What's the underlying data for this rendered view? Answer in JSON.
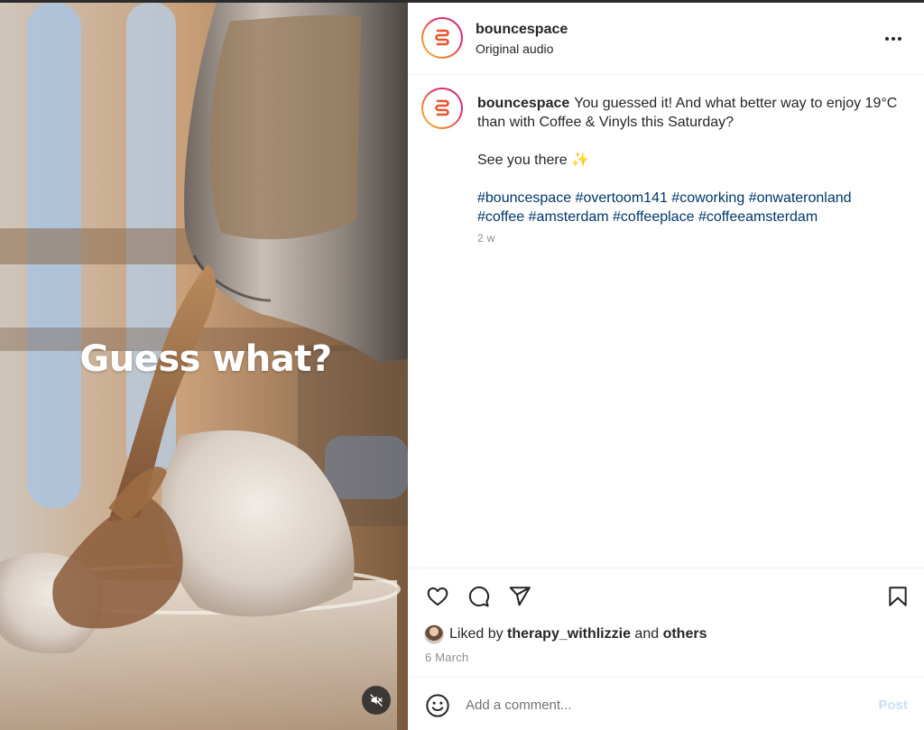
{
  "post": {
    "username": "bouncespace",
    "audio_label": "Original audio",
    "overlay_text": "Guess what?",
    "caption": {
      "username": "bouncespace",
      "line1": "You guessed it! And what better way to enjoy 19°C than with Coffee & Vinyls this Saturday?",
      "line2": "See you there ✨",
      "hashtags": [
        "#bouncespace",
        "#overtoom141",
        "#coworking",
        "#onwateronland",
        "#coffee",
        "#amsterdam",
        "#coffeeplace",
        "#coffeeamsterdam"
      ],
      "age": "2 w"
    },
    "likes": {
      "prefix": "Liked by",
      "user": "therapy_withlizzie",
      "joiner": "and",
      "others": "others"
    },
    "date": "6 March",
    "comment": {
      "placeholder": "Add a comment...",
      "post_label": "Post"
    }
  },
  "icons": {
    "more": "more-options-icon",
    "like": "heart-icon",
    "comment": "comment-icon",
    "share": "share-icon",
    "save": "bookmark-icon",
    "emoji": "emoji-icon",
    "mute": "muted-speaker-icon",
    "logo": "bouncespace-logo-icon"
  },
  "colors": {
    "link": "#00376b",
    "muted": "#8e8e8e",
    "post_disabled": "#c7e0f8",
    "brand_orange": "#e8542c"
  }
}
